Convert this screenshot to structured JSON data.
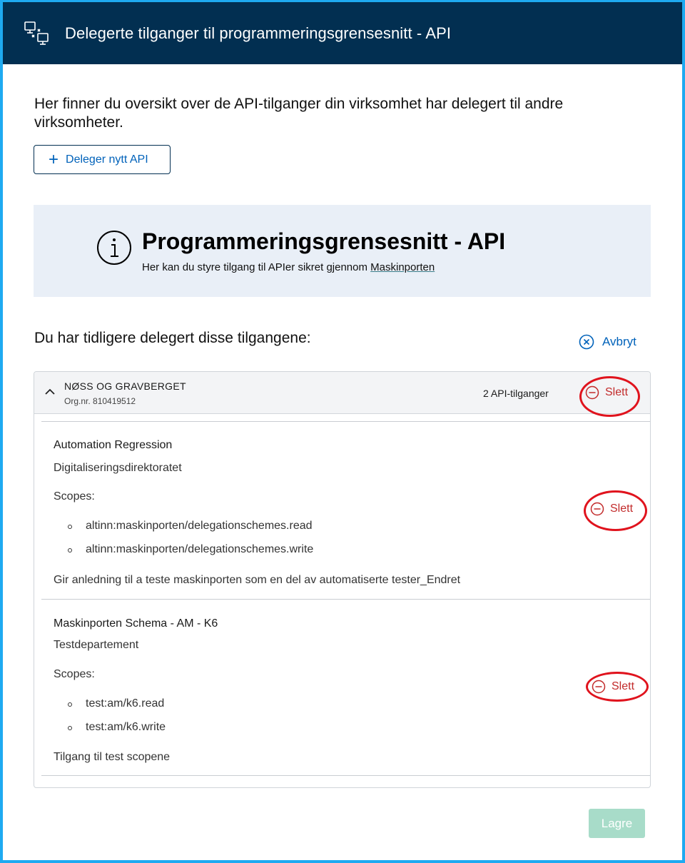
{
  "header": {
    "title": "Delegerte tilganger til programmeringsgrensesnitt - API",
    "icon": "api-delegation-icon"
  },
  "intro": "Her finner du oversikt over de API-tilganger din virksomhet har delegert til andre virksomheter.",
  "deleger_button": {
    "label": "Deleger nytt API",
    "icon": "plus-icon"
  },
  "info_panel": {
    "title": "Programmeringsgrensesnitt - API",
    "subtitle_prefix": "Her kan du styre tilgang til APIer sikret gjennom ",
    "link_text": "Maskinporten",
    "icon": "info-icon"
  },
  "section": {
    "heading": "Du har tidligere delegert disse tilgangene:",
    "cancel_label": "Avbryt"
  },
  "organization": {
    "name": "NØSS OG GRAVBERGET",
    "org_nr": "Org.nr. 810419512",
    "api_count": "2 API-tilganger",
    "delete_label": "Slett"
  },
  "apis": [
    {
      "name": "Automation Regression",
      "owner": "Digitaliseringsdirektoratet",
      "scopes_label": "Scopes:",
      "scopes": [
        "altinn:maskinporten/delegationschemes.read",
        "altinn:maskinporten/delegationschemes.write"
      ],
      "description": "Gir anledning til a teste maskinporten som en del av automatiserte tester_Endret",
      "delete_label": "Slett"
    },
    {
      "name": "Maskinporten Schema - AM - K6",
      "owner": "Testdepartement",
      "scopes_label": "Scopes:",
      "scopes": [
        "test:am/k6.read",
        "test:am/k6.write"
      ],
      "description": "Tilgang til test scopene",
      "delete_label": "Slett"
    }
  ],
  "save_button": {
    "label": "Lagre"
  },
  "colors": {
    "header_bg": "#022f51",
    "frame_border": "#1eaaf1",
    "link_blue": "#0062ba",
    "danger_red": "#c22b2b",
    "annotation_red": "#e0131d",
    "info_bg": "#e9eff7",
    "save_disabled": "#a8dcc9"
  }
}
